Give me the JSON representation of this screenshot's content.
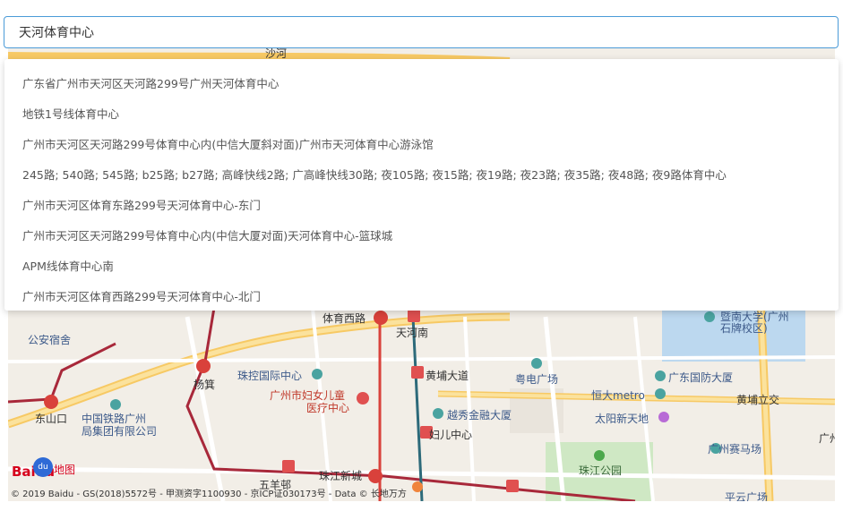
{
  "search": {
    "value": "天河体育中心"
  },
  "suggestions": [
    "广东省广州市天河区天河路299号广州天河体育中心",
    "地铁1号线体育中心",
    "广州市天河区天河路299号体育中心内(中信大厦斜对面)广州市天河体育中心游泳馆",
    "245路; 540路; 545路; b25路; b27路; 高峰快线2路; 广高峰快线30路; 夜105路; 夜15路; 夜19路; 夜23路; 夜35路; 夜48路; 夜9路体育中心",
    "广州市天河区体育东路299号天河体育中心-东门",
    "广州市天河区天河路299号体育中心内(中信大厦对面)天河体育中心-篮球城",
    "APM线体育中心南",
    "广州市天河区体育西路299号天河体育中心-北门"
  ],
  "map": {
    "labels": {
      "gongan": "公安宿舍",
      "tiyuxilu": "体育西路",
      "tianhenan": "天河南",
      "jinan": "暨南大学(广州",
      "shipai": "石牌校区)",
      "zhukong": "珠控国际中心",
      "yangji": "杨箕",
      "huangpudadao": "黄埔大道",
      "yuedian": "粤电广场",
      "guangdongguofang": "广东国防大厦",
      "fuyou1": "广州市妇女儿童",
      "fuyou2": "医疗中心",
      "hengdajin": "恒大metro",
      "huangpulijiao": "黄埔立交",
      "dongshankou": "东山口",
      "tielu1": "中国铁路广州",
      "tielu2": "局集团有限公司",
      "yuexiu": "越秀金融大厦",
      "taiyang": "太阳新天地",
      "fuerzhongxin": "妇儿中心",
      "saima": "广州赛马场",
      "zhujianggongyuan": "珠江公园",
      "zhujiangxincheng": "珠江新城",
      "wuyangbang": "五羊邨",
      "pingyun": "平云广场",
      "guang": "广州",
      "shahe": "沙河"
    },
    "logo_text": "地图",
    "logo_brand": "Baidu",
    "copyright": "© 2019 Baidu - GS(2018)5572号 - 甲测资字1100930 - 京ICP证030173号 - Data © 长地万方"
  }
}
